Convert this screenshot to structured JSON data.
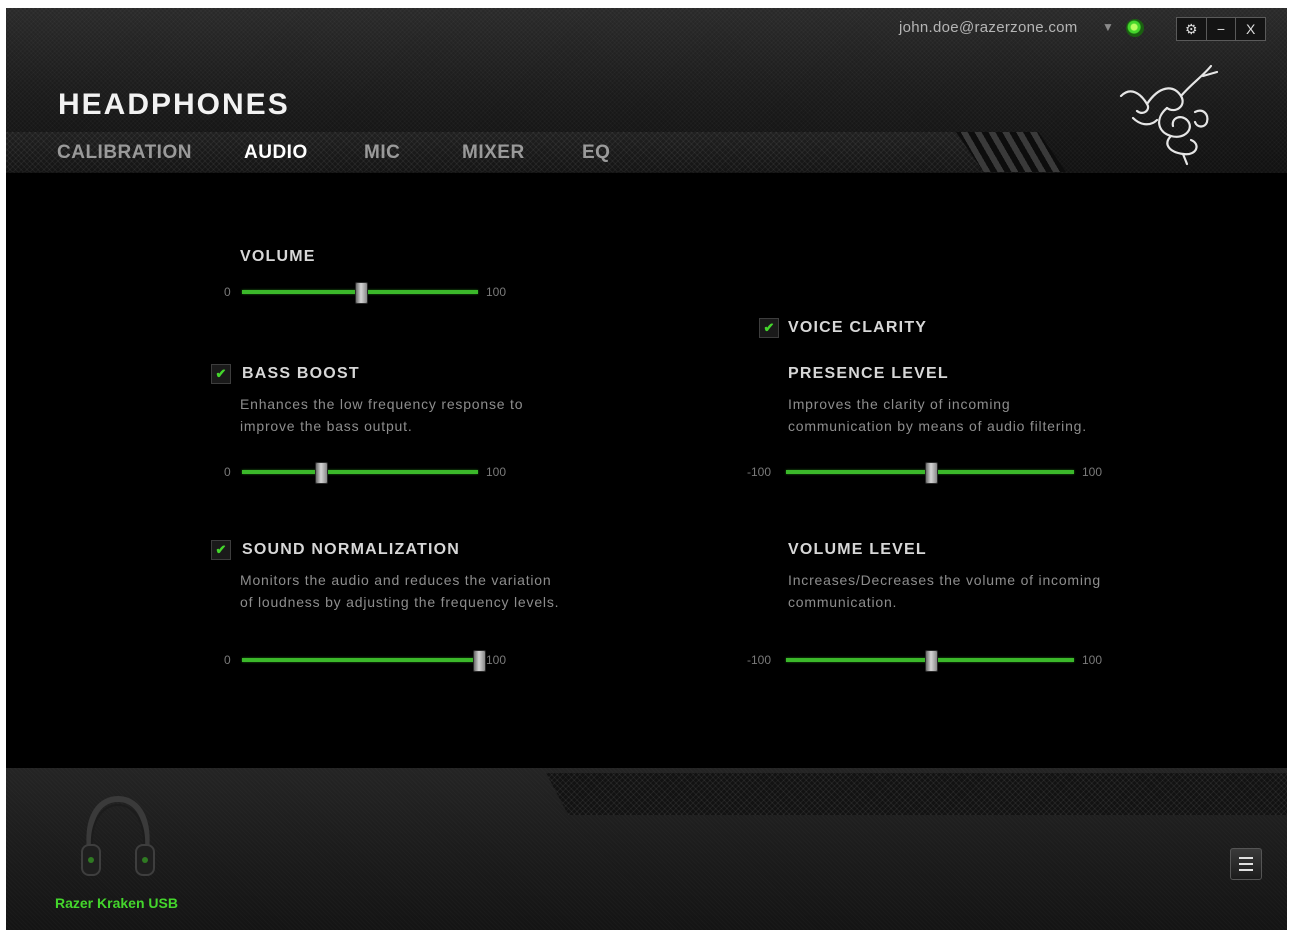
{
  "account": {
    "email": "john.doe@razerzone.com"
  },
  "window_controls": {
    "settings": "⚙",
    "minimize": "−",
    "close": "X"
  },
  "header": {
    "title": "HEADPHONES"
  },
  "tabs": [
    "CALIBRATION",
    "AUDIO",
    "MIC",
    "MIXER",
    "EQ"
  ],
  "active_tab": "AUDIO",
  "volume": {
    "label": "VOLUME",
    "min": "0",
    "max": "100",
    "value": 50
  },
  "bass_boost": {
    "label": "BASS BOOST",
    "checked": true,
    "desc1": "Enhances the low frequency response to",
    "desc2": "improve the bass output.",
    "min": "0",
    "max": "100",
    "value": 33
  },
  "sound_normalization": {
    "label": "SOUND NORMALIZATION",
    "checked": true,
    "desc1": "Monitors the audio and reduces the variation",
    "desc2": "of loudness by adjusting the frequency levels.",
    "min": "0",
    "max": "100",
    "value": 100
  },
  "voice_clarity": {
    "label": "VOICE CLARITY",
    "checked": true
  },
  "presence_level": {
    "label": "PRESENCE LEVEL",
    "desc1": "Improves the clarity of incoming",
    "desc2": "communication by means of audio filtering.",
    "min": "-100",
    "max": "100",
    "value": 0
  },
  "volume_level": {
    "label": "VOLUME LEVEL",
    "desc1": "Increases/Decreases the volume of incoming",
    "desc2": "communication.",
    "min": "-100",
    "max": "100",
    "value": 0
  },
  "device": {
    "name": "Razer Kraken USB"
  },
  "colors": {
    "accent": "#44d62c",
    "background": "#000000",
    "text": "#d7d7d7"
  },
  "icons": [
    "dropdown-arrow-icon",
    "status-icon",
    "settings-icon",
    "minimize-icon",
    "close-icon",
    "razer-logo-icon",
    "checkmark-icon",
    "headset-icon",
    "menu-icon"
  ]
}
